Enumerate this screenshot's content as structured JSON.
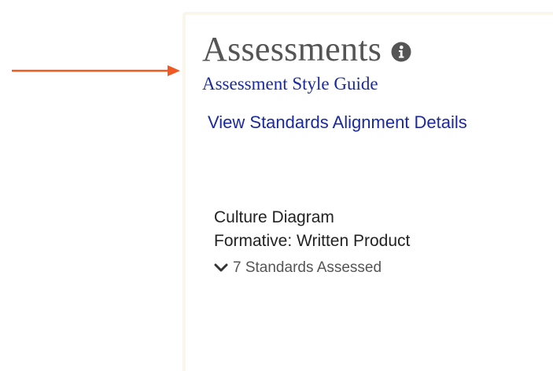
{
  "annotation": {
    "arrow_color": "#f05a22"
  },
  "panel": {
    "heading": "Assessments",
    "info_icon": "info-circle-icon",
    "style_guide_link": "Assessment Style Guide",
    "standards_link": "View Standards Alignment Details"
  },
  "assessment": {
    "title": "Culture Diagram",
    "type": "Formative: Written Product",
    "standards_toggle": "7 Standards Assessed",
    "toggle_icon": "chevron-down-icon"
  },
  "colors": {
    "link": "#1a2a9c",
    "heading": "#555555",
    "panel_border": "#fbf6ec"
  }
}
